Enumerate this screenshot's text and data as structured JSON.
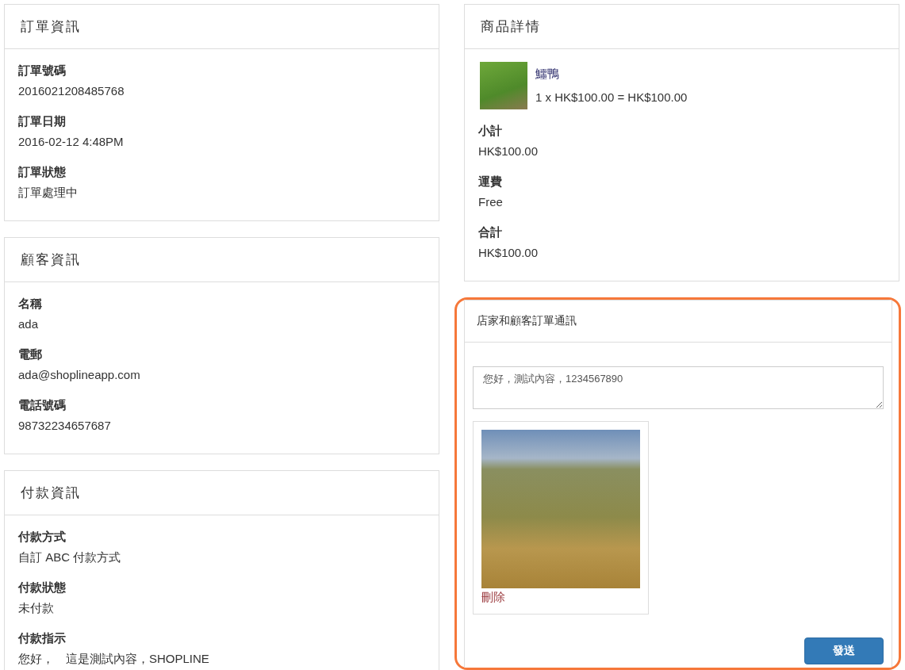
{
  "left_panels": [
    {
      "title": "訂單資訊",
      "fields": [
        {
          "label": "訂單號碼",
          "value": "2016021208485768"
        },
        {
          "label": "訂單日期",
          "value": "2016-02-12 4:48PM"
        },
        {
          "label": "訂單狀態",
          "value": "訂單處理中"
        }
      ]
    },
    {
      "title": "顧客資訊",
      "fields": [
        {
          "label": "名稱",
          "value": "ada"
        },
        {
          "label": "電郵",
          "value": "ada@shoplineapp.com"
        },
        {
          "label": "電話號碼",
          "value": "98732234657687"
        }
      ]
    },
    {
      "title": "付款資訊",
      "fields": [
        {
          "label": "付款方式",
          "value": "自訂 ABC 付款方式"
        },
        {
          "label": "付款狀態",
          "value": "未付款"
        },
        {
          "label": "付款指示",
          "value": "您好，　這是測試內容，SHOPLINE"
        }
      ]
    }
  ],
  "product_details": {
    "title": "商品詳情",
    "items": [
      {
        "name": "鱷鴨",
        "line": "1 x HK$100.00 = HK$100.00"
      }
    ],
    "fields": [
      {
        "label": "小計",
        "value": "HK$100.00"
      },
      {
        "label": "運費",
        "value": "Free"
      },
      {
        "label": "合計",
        "value": "HK$100.00"
      }
    ]
  },
  "messages": {
    "title": "店家和顧客訂單通訊",
    "message_box": {
      "value": "您好，測試內容，1234567890"
    },
    "attachments": [
      {
        "delete_link": "刪除"
      }
    ],
    "send_button": "發送"
  }
}
